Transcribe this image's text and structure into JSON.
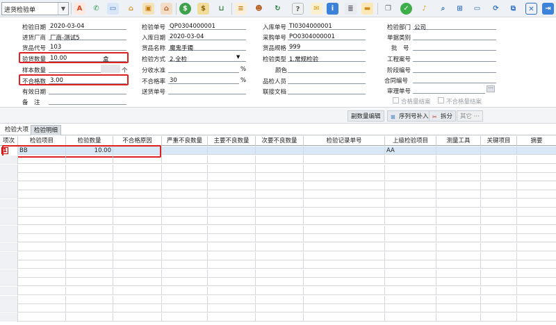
{
  "toolbar": {
    "doc_type": "进货检验单",
    "icons": [
      "abc-icon",
      "phone-icon",
      "monitor-icon",
      "lock-icon",
      "briefcase-icon",
      "home-icon",
      "dollar-icon",
      "money-bag-icon",
      "cart-icon",
      "document-icon",
      "people-icon",
      "refresh-icon",
      "help-icon",
      "mail-icon",
      "info-icon",
      "list-icon",
      "folder-icon",
      "copy-icon",
      "check-icon",
      "bell-icon",
      "search-icon",
      "org-chart-icon",
      "screen-icon",
      "sync-icon",
      "window-icon",
      "close-icon",
      "exit-icon"
    ]
  },
  "form": {
    "col1": {
      "inspection_date_label": "检验日期",
      "inspection_date": "2020-03-04",
      "supplier_label": "进货厂商",
      "supplier": "厂商-测试5",
      "product_code_label": "货品代号",
      "product_code": "103",
      "inspect_qty_label": "验货数量",
      "inspect_qty": "10.00",
      "inspect_unit": "盒",
      "sample_qty_label": "样本数量",
      "sample_unit": "个",
      "reject_qty_label": "不合格数",
      "reject_qty": "3.00",
      "valid_date_label": "有效日期",
      "remark_label": "备　注"
    },
    "col2": {
      "inspection_no_label": "检验单号",
      "inspection_no": "QP0304000001",
      "stock_in_date_label": "入库日期",
      "stock_in_date": "2020-03-04",
      "product_name_label": "货品名称",
      "product_name": "魔鬼手镯",
      "inspect_method_label": "检验方式",
      "inspect_method": "2.全检",
      "moisture_label": "分收水准",
      "percent1": "%",
      "reject_rate_label": "不合格率",
      "reject_rate": "30",
      "percent2": "%",
      "delivery_no_label": "送货单号"
    },
    "col3": {
      "stock_in_no_label": "入库单号",
      "stock_in_no": "TI0304000001",
      "purchase_no_label": "采购单号",
      "purchase_no": "PO0304000001",
      "spec_label": "货品规格",
      "spec": "999",
      "inspect_type_label": "检验类型",
      "inspect_type": "1.常规检验",
      "color_label": "颜色",
      "inspector_label": "品检人员",
      "linked_doc_label": "联接文档"
    },
    "col4": {
      "dept_label": "检验部门",
      "dept": "公司",
      "doc_category_label": "单据类别",
      "batch_label": "批　号",
      "project_no_label": "工程案号",
      "stage_no_label": "阶段编号",
      "contract_no_label": "合同编号",
      "reviewer_label": "审理单号",
      "more_btn": "···",
      "qualified_closed": "合格量结案",
      "unqualified_closed": "不合格量结案"
    }
  },
  "actions": {
    "edit_subqty": "副数量编辑",
    "serial_fill": "序列号补入",
    "split": "拆分",
    "other": "其它 ···"
  },
  "tabs": [
    {
      "label": "检验大项"
    },
    {
      "label": "检验明细"
    }
  ],
  "grid": {
    "columns": [
      "项次",
      "检验项目",
      "检验数量",
      "不合格原因",
      "严重不良数量",
      "主要不良数量",
      "次要不良数量",
      "检验记录单号",
      "上级检验项目",
      "测量工具",
      "关键项目",
      "摘要"
    ],
    "rows": [
      {
        "no": "1",
        "item": "BB",
        "qty": "10.00",
        "reason": "",
        "severe": "",
        "major": "",
        "minor": "",
        "record_no": "",
        "parent_item": "AA",
        "tool": "",
        "key": "",
        "summary": ""
      }
    ]
  },
  "colors": {
    "highlight": "#e02020",
    "selected_row": "#d9e8f7",
    "toolbar_bg": "#eef1f5"
  }
}
